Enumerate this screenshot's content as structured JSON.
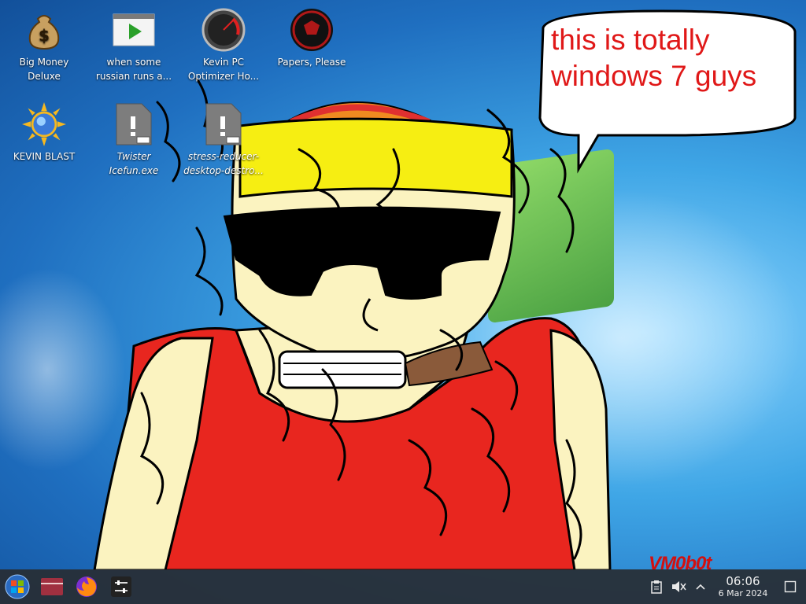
{
  "desktop": {
    "icons": [
      {
        "label": "Big Money Deluxe",
        "icon": "money-bag-icon"
      },
      {
        "label": "when some russian runs a...",
        "icon": "video-player-icon"
      },
      {
        "label": "Kevin PC Optimizer Ho...",
        "icon": "speedometer-icon"
      },
      {
        "label": "Papers, Please",
        "icon": "papers-please-emblem-icon"
      },
      {
        "label": "KEVIN BLAST",
        "icon": "sun-globe-icon"
      },
      {
        "label": "Twister Icefun.exe",
        "icon": "executable-icon"
      },
      {
        "label": "stress-reducer-desktop-destro...",
        "icon": "executable-icon"
      }
    ]
  },
  "wallpaper": {
    "speech_bubble": [
      "this is totally",
      "windows 7 guys"
    ],
    "signature": "VM0b0t"
  },
  "taskbar": {
    "launcher": "start-orb-icon",
    "pinned": [
      "file-manager-icon",
      "firefox-icon",
      "mixer-icon"
    ],
    "tray": [
      "clipboard-icon",
      "volume-muted-icon",
      "chevron-up-icon"
    ],
    "clock": {
      "time": "06:06",
      "date": "6 Mar 2024"
    }
  },
  "colors": {
    "bubble_text": "#e01818",
    "taskbar": "#282d34",
    "shirt": "#e8261f",
    "cap": "#f6ee12"
  }
}
